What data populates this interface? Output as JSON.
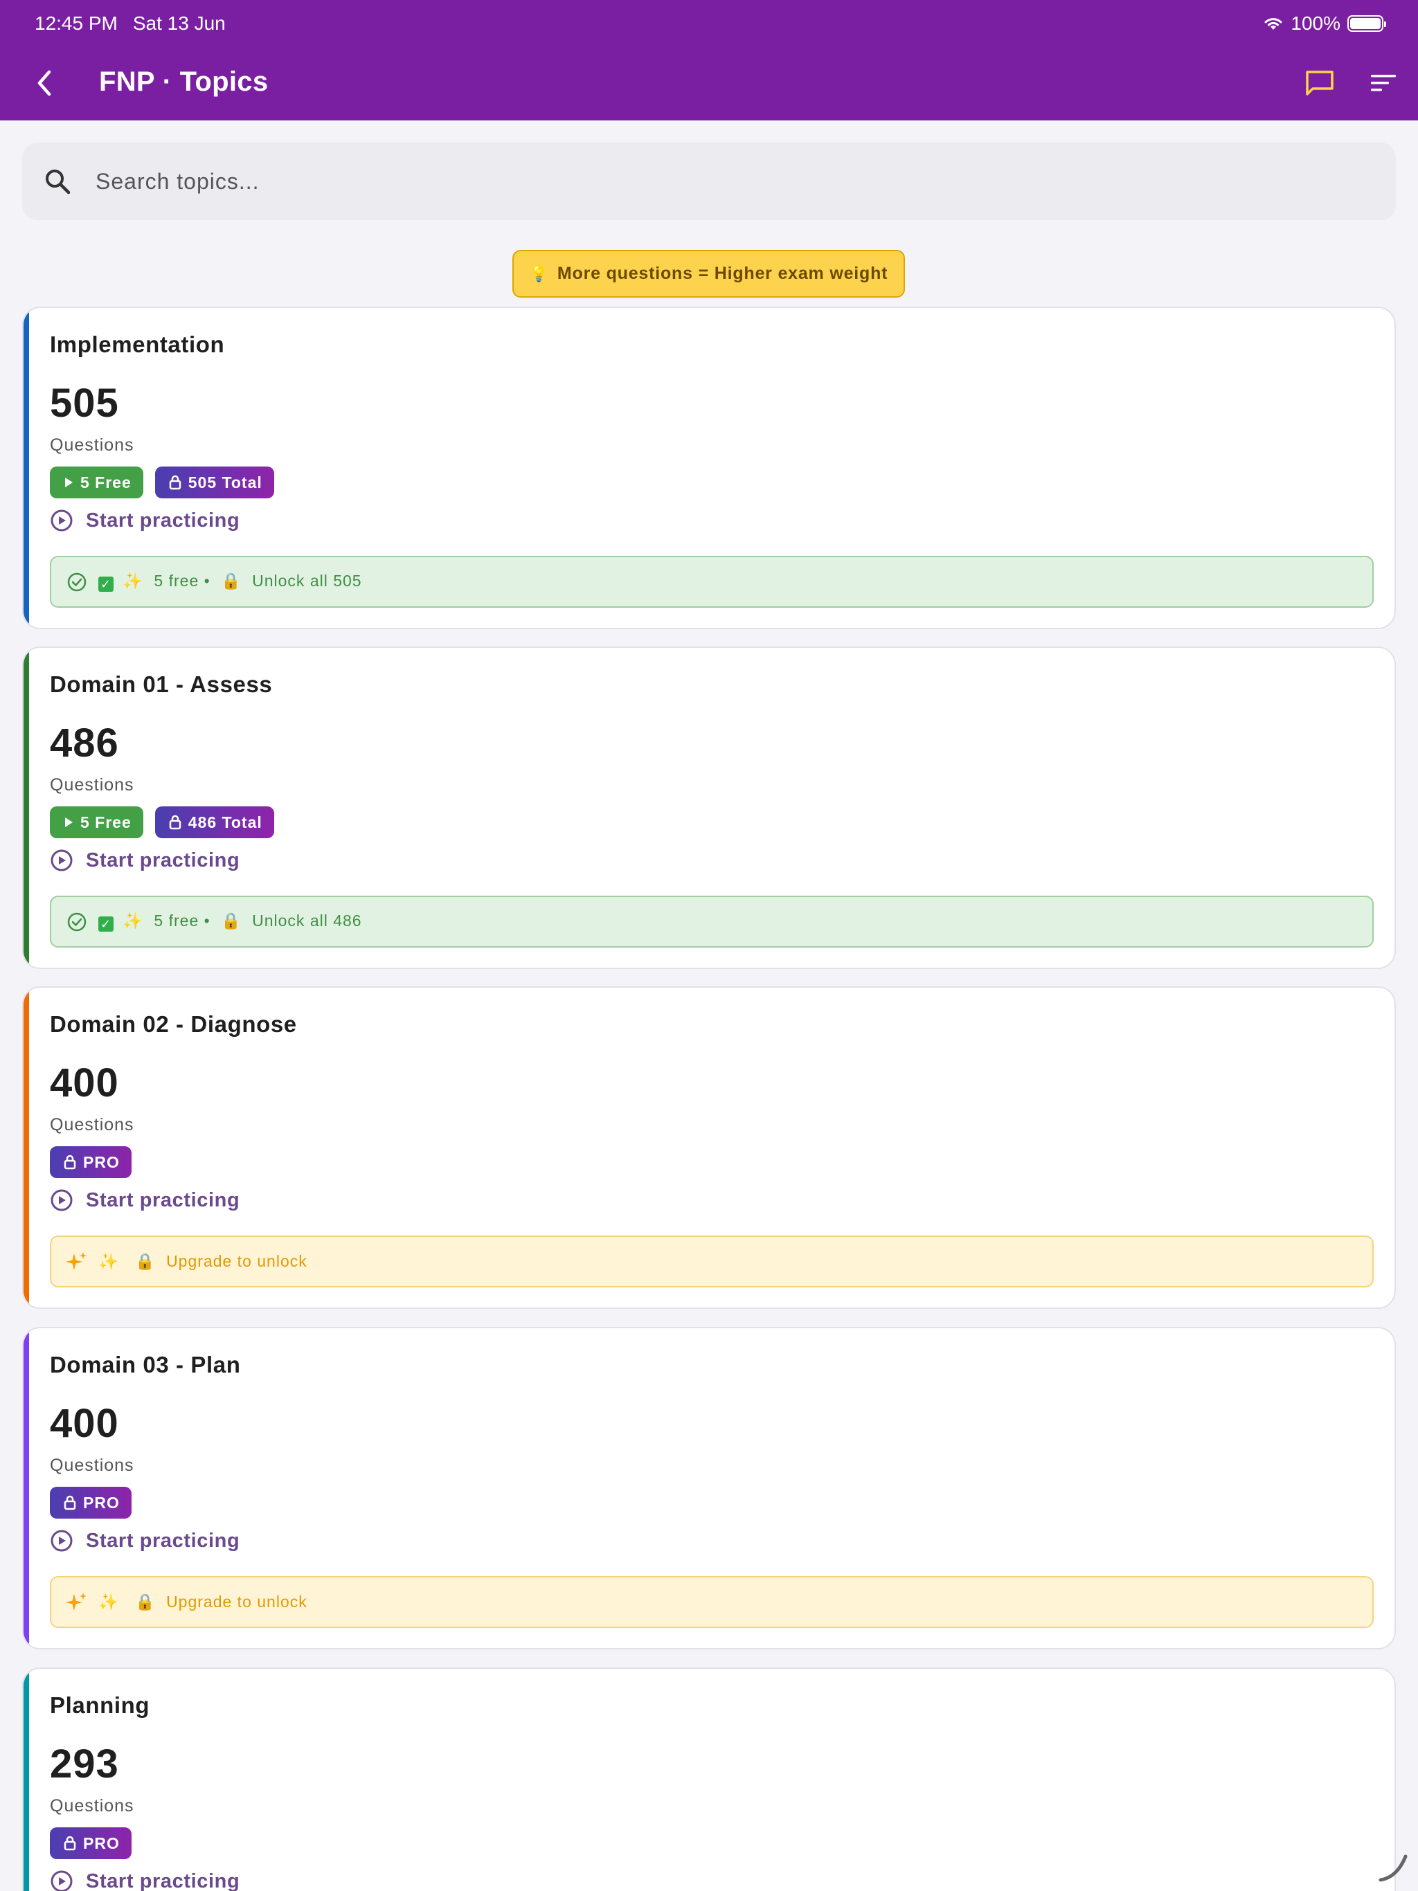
{
  "status_bar": {
    "time": "12:45 PM",
    "date": "Sat 13 Jun",
    "battery": "100%"
  },
  "header": {
    "title": "FNP · Topics"
  },
  "search": {
    "placeholder": "Search topics..."
  },
  "tip": {
    "icon": "💡",
    "text": "More questions = Higher exam weight"
  },
  "colors": {
    "appbar": "#7b1fa2",
    "free": "#43a047",
    "pro_from": "#4a3fb0",
    "pro_to": "#8e24aa",
    "accent_action": "#6a4a8c"
  },
  "cards": [
    {
      "title": "Implementation",
      "count": "505",
      "count_label": "Questions",
      "accent": "#1565c0",
      "badges": [
        {
          "type": "free",
          "label": "5 Free"
        },
        {
          "type": "total",
          "label": "505 Total"
        }
      ],
      "action": "Start practicing",
      "notice": {
        "type": "green",
        "emoji_check": "✓",
        "sparkle": "✨",
        "text_free": "5 free",
        "separator": "•",
        "lock": "🔒",
        "text_unlock": "Unlock all 505"
      }
    },
    {
      "title": "Domain 01 - Assess",
      "count": "486",
      "count_label": "Questions",
      "accent": "#2e7d32",
      "badges": [
        {
          "type": "free",
          "label": "5 Free"
        },
        {
          "type": "total",
          "label": "486 Total"
        }
      ],
      "action": "Start practicing",
      "notice": {
        "type": "green",
        "emoji_check": "✓",
        "sparkle": "✨",
        "text_free": "5 free",
        "separator": "•",
        "lock": "🔒",
        "text_unlock": "Unlock all 486"
      }
    },
    {
      "title": "Domain 02 - Diagnose",
      "count": "400",
      "count_label": "Questions",
      "accent": "#ef6c00",
      "badges": [
        {
          "type": "pro",
          "label": "PRO"
        }
      ],
      "action": "Start practicing",
      "notice": {
        "type": "yellow",
        "sparkle": "✨",
        "lock": "🔒",
        "text": "Upgrade to unlock"
      }
    },
    {
      "title": "Domain 03 - Plan",
      "count": "400",
      "count_label": "Questions",
      "accent": "#7e3ff2",
      "badges": [
        {
          "type": "pro",
          "label": "PRO"
        }
      ],
      "action": "Start practicing",
      "notice": {
        "type": "yellow",
        "sparkle": "✨",
        "lock": "🔒",
        "text": "Upgrade to unlock"
      }
    },
    {
      "title": "Planning",
      "count": "293",
      "count_label": "Questions",
      "accent": "#0097a7",
      "badges": [
        {
          "type": "pro",
          "label": "PRO"
        }
      ],
      "action": "Start practicing"
    }
  ]
}
